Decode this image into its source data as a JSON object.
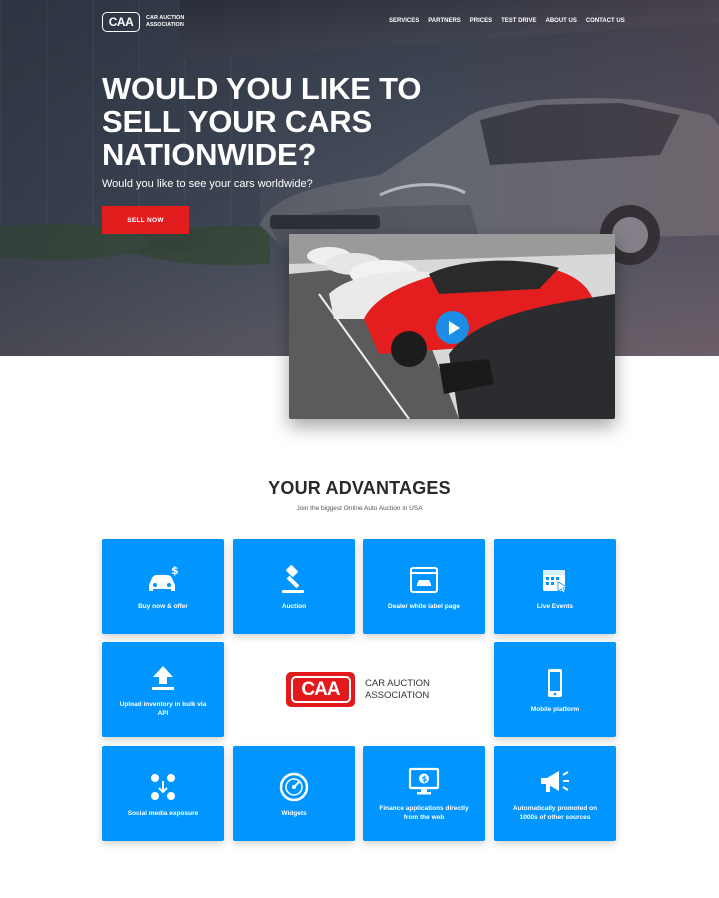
{
  "header": {
    "logo_mark": "CAA",
    "logo_text": "Car Auction Association",
    "nav": [
      "Services",
      "Partners",
      "Prices",
      "Test Drive",
      "About Us",
      "Contact Us"
    ]
  },
  "hero": {
    "headline": "Would you like to sell your cars nationwide?",
    "subheadline": "Would you like to see your cars worldwide?",
    "cta_label": "Sell now"
  },
  "advantages": {
    "title": "YOUR ADVANTAGES",
    "subtitle": "Join the biggest Online Auto Auction in USA",
    "center_logo_mark": "CAA",
    "center_logo_text": "Car Auction Association",
    "tiles": [
      {
        "label": "Buy now & offer",
        "icon": "car-dollar-icon"
      },
      {
        "label": "Auction",
        "icon": "gavel-icon"
      },
      {
        "label": "Dealer white label page",
        "icon": "browser-car-icon"
      },
      {
        "label": "Live Events",
        "icon": "calendar-cursor-icon"
      },
      {
        "label": "Upload inventory in bulk via API",
        "icon": "upload-icon"
      },
      {
        "label": "Mobile platform",
        "icon": "mobile-icon"
      },
      {
        "label": "Social media exposure",
        "icon": "social-share-icon"
      },
      {
        "label": "Widgets",
        "icon": "speedometer-icon"
      },
      {
        "label": "Finance applications directly from the web",
        "icon": "monitor-dollar-icon"
      },
      {
        "label": "Automatically promoted on 1000s of other sources",
        "icon": "megaphone-icon"
      }
    ]
  },
  "colors": {
    "accent_red": "#e21d1d",
    "tile_blue": "#0095ff",
    "play_blue": "#1c8ee6"
  }
}
